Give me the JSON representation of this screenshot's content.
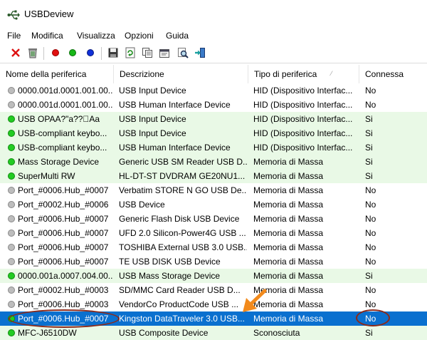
{
  "window": {
    "title": "USBDeview"
  },
  "menu": [
    "File",
    "Modifica",
    "Visualizza",
    "Opzioni",
    "Guida"
  ],
  "toolbar": {
    "icons": [
      "delete-icon",
      "uninstall-icon",
      "red-dot-icon",
      "green-dot-icon",
      "blue-dot-icon",
      "save-icon",
      "refresh-icon",
      "copy-icon",
      "properties-icon",
      "find-icon",
      "exit-icon"
    ],
    "colors": {
      "red": "#e01010",
      "green": "#18b818",
      "blue": "#1030d8"
    }
  },
  "table": {
    "columns": [
      "Nome della periferica",
      "Descrizione",
      "Tipo di periferica",
      "Connessa"
    ],
    "rows": [
      {
        "name": "0000.001d.0001.001.00...",
        "desc": "USB Input Device",
        "type": "HID (Dispositivo Interfac...",
        "connected": "No",
        "status": "gray",
        "bg": "white"
      },
      {
        "name": "0000.001d.0001.001.00...",
        "desc": "USB Human Interface Device",
        "type": "HID (Dispositivo Interfac...",
        "connected": "No",
        "status": "gray",
        "bg": "white"
      },
      {
        "name": "USB OPAA?\"a??\u0000Aa",
        "desc": "USB Input Device",
        "type": "HID (Dispositivo Interfac...",
        "connected": "Si",
        "status": "green",
        "bg": "green"
      },
      {
        "name": "USB-compliant keybo...",
        "desc": "USB Input Device",
        "type": "HID (Dispositivo Interfac...",
        "connected": "Si",
        "status": "green",
        "bg": "green"
      },
      {
        "name": "USB-compliant keybo...",
        "desc": "USB Human Interface Device",
        "type": "HID (Dispositivo Interfac...",
        "connected": "Si",
        "status": "green",
        "bg": "green"
      },
      {
        "name": "Mass Storage Device",
        "desc": "Generic USB SM Reader USB D...",
        "type": "Memoria di Massa",
        "connected": "Si",
        "status": "green",
        "bg": "green"
      },
      {
        "name": "SuperMulti RW",
        "desc": "HL-DT-ST DVDRAM GE20NU1...",
        "type": "Memoria di Massa",
        "connected": "Si",
        "status": "green",
        "bg": "green"
      },
      {
        "name": "Port_#0006.Hub_#0007",
        "desc": "Verbatim STORE N GO USB De...",
        "type": "Memoria di Massa",
        "connected": "No",
        "status": "gray",
        "bg": "white"
      },
      {
        "name": "Port_#0002.Hub_#0006",
        "desc": "USB Device",
        "type": "Memoria di Massa",
        "connected": "No",
        "status": "gray",
        "bg": "white"
      },
      {
        "name": "Port_#0006.Hub_#0007",
        "desc": "Generic Flash Disk USB Device",
        "type": "Memoria di Massa",
        "connected": "No",
        "status": "gray",
        "bg": "white"
      },
      {
        "name": "Port_#0006.Hub_#0007",
        "desc": "UFD 2.0 Silicon-Power4G USB ...",
        "type": "Memoria di Massa",
        "connected": "No",
        "status": "gray",
        "bg": "white"
      },
      {
        "name": "Port_#0006.Hub_#0007",
        "desc": "TOSHIBA External USB 3.0 USB...",
        "type": "Memoria di Massa",
        "connected": "No",
        "status": "gray",
        "bg": "white"
      },
      {
        "name": "Port_#0006.Hub_#0007",
        "desc": "TE USB DISK USB Device",
        "type": "Memoria di Massa",
        "connected": "No",
        "status": "gray",
        "bg": "white"
      },
      {
        "name": "0000.001a.0007.004.00...",
        "desc": "USB Mass Storage Device",
        "type": "Memoria di Massa",
        "connected": "Si",
        "status": "green",
        "bg": "green"
      },
      {
        "name": "Port_#0002.Hub_#0003",
        "desc": "SD/MMC Card  Reader USB D...",
        "type": "Memoria di Massa",
        "connected": "No",
        "status": "gray",
        "bg": "white"
      },
      {
        "name": "Port_#0006.Hub_#0003",
        "desc": "VendorCo ProductCode USB ...",
        "type": "Memoria di Massa",
        "connected": "No",
        "status": "gray",
        "bg": "white"
      },
      {
        "name": "Port_#0006.Hub_#0007",
        "desc": "Kingston DataTraveler 3.0 USB...",
        "type": "Memoria di Massa",
        "connected": "No",
        "status": "green",
        "bg": "selected"
      },
      {
        "name": "MFC-J6510DW",
        "desc": "USB Composite Device",
        "type": "Sconosciuta",
        "connected": "Si",
        "status": "green",
        "bg": "green"
      }
    ]
  },
  "annotation": {
    "color": "#8b2a1a",
    "arrow_color": "#f28a1c"
  }
}
